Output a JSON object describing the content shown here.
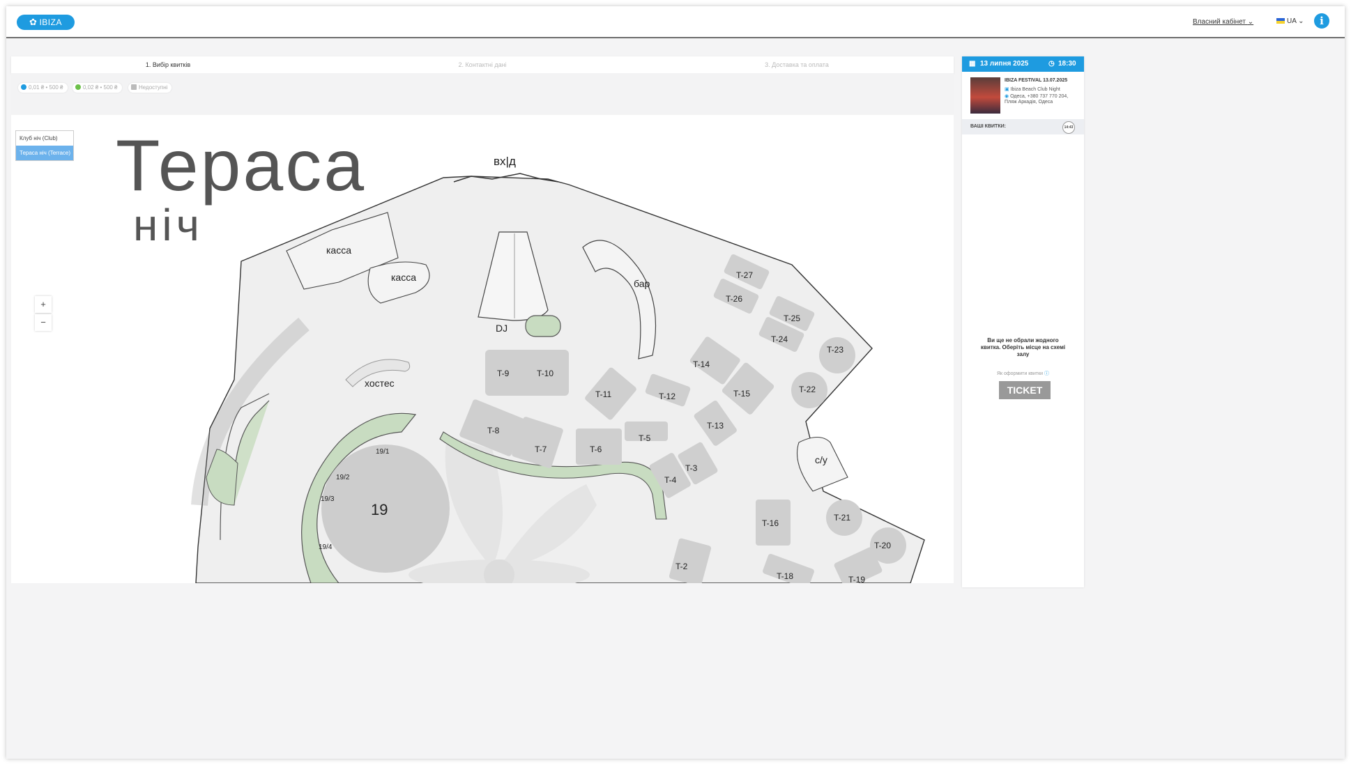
{
  "header": {
    "logo": "IBIZA",
    "cabinet": "Власний кабінет",
    "lang": "UA",
    "info": "i"
  },
  "steps": [
    {
      "label": "1. Вибір квитків"
    },
    {
      "label": "2. Контактні дані"
    },
    {
      "label": "3. Доставка та оплата"
    }
  ],
  "legend": [
    {
      "label": "0,01 ₴ • 500 ₴",
      "color": "#1e9be0"
    },
    {
      "label": "0,02 ₴ • 500 ₴",
      "color": "#6cc04a"
    },
    {
      "label": "Недоступні",
      "color": "#bbbbbb"
    }
  ],
  "halls": [
    {
      "label": "Клуб ніч (Club)"
    },
    {
      "label": "Тераса ніч (Terrace)"
    }
  ],
  "zoom": {
    "in": "+",
    "out": "−"
  },
  "map": {
    "title": "Тераса",
    "subtitle": "ніч",
    "entrance": "вх|д",
    "labels": {
      "cashier1": "касса",
      "cashier2": "касса",
      "dj": "DJ",
      "bar": "бар",
      "hostess": "хостес",
      "wc": "с/у"
    },
    "tables": [
      "T-27",
      "T-26",
      "T-25",
      "T-24",
      "T-23",
      "T-22",
      "T-14",
      "T-15",
      "T-13",
      "T-12",
      "T-11",
      "T-10",
      "T-9",
      "T-8",
      "T-7",
      "T-6",
      "T-5",
      "T-4",
      "T-3",
      "T-2",
      "T-16",
      "T-18",
      "T-19",
      "T-20",
      "T-21"
    ],
    "main_table": "19",
    "sub_tables": [
      "19/1",
      "19/2",
      "19/3",
      "19/4"
    ]
  },
  "sidebar": {
    "date": "13 липня 2025",
    "time": "18:30",
    "event_title": "IBIZA FESTIVAL 13.07.2025",
    "venue": "Ibiza Beach Club Night",
    "address": "Одеса, +380 737 770 204, Пляж Аркадія, Одеса",
    "your_tickets": "ВАШІ КВИТКИ:",
    "timer": "14:43",
    "empty_msg": "Ви ще не обрали жодного квитка. Оберіть місце на схемі залу",
    "howto": "Як оформити квитки",
    "ticket_logo": "TICKET"
  }
}
